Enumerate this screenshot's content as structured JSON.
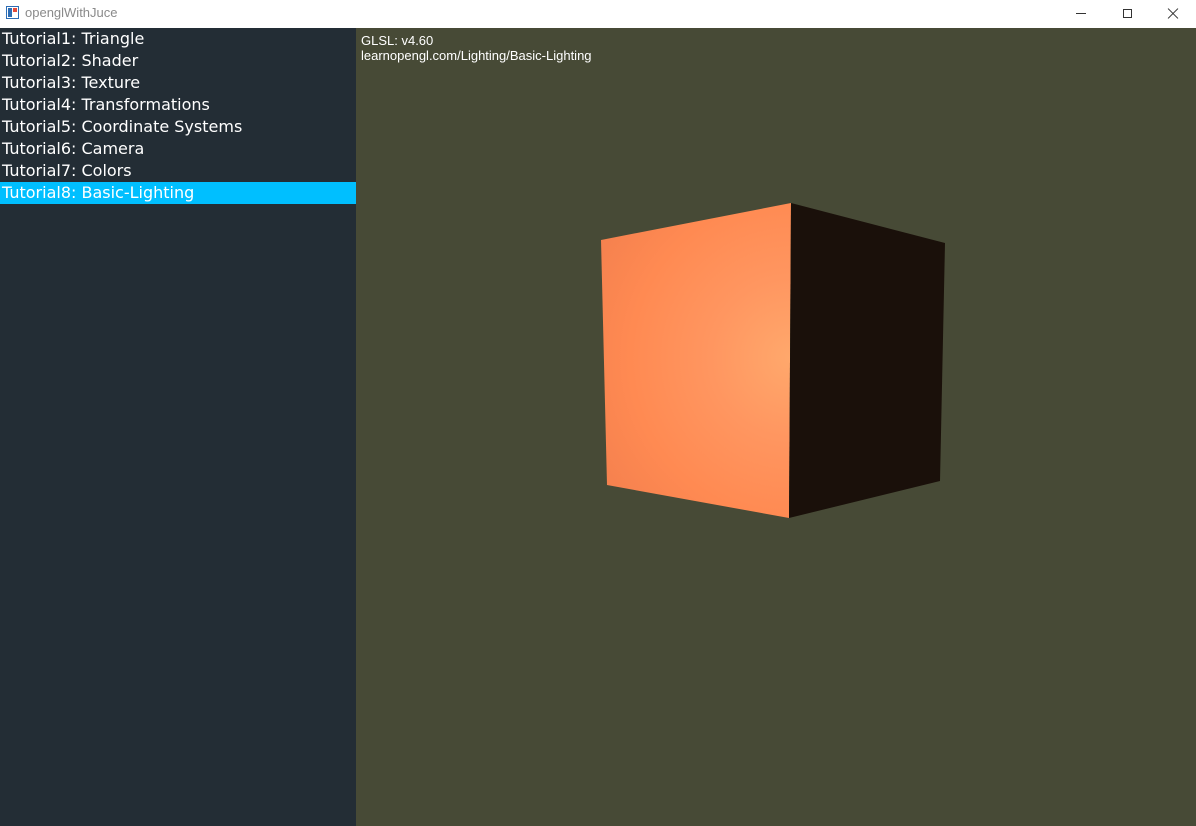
{
  "window": {
    "title": "openglWithJuce",
    "icons": {
      "app": "app-icon",
      "minimize": "minimize-icon",
      "maximize": "maximize-icon",
      "close": "close-icon"
    }
  },
  "sidebar": {
    "items": [
      {
        "label": "Tutorial1: Triangle",
        "selected": false
      },
      {
        "label": "Tutorial2: Shader",
        "selected": false
      },
      {
        "label": "Tutorial3: Texture",
        "selected": false
      },
      {
        "label": "Tutorial4: Transformations",
        "selected": false
      },
      {
        "label": "Tutorial5: Coordinate Systems",
        "selected": false
      },
      {
        "label": "Tutorial6: Camera",
        "selected": false
      },
      {
        "label": "Tutorial7: Colors",
        "selected": false
      },
      {
        "label": "Tutorial8: Basic-Lighting",
        "selected": true
      }
    ]
  },
  "viewport": {
    "glsl_version": "GLSL: v4.60",
    "tutorial_url": "learnopengl.com/Lighting/Basic-Lighting"
  },
  "colors": {
    "sidebar_bg": "#232d35",
    "selected_bg": "#00bfff",
    "viewport_bg": "#474a36",
    "cube_lit": "#ff8550",
    "cube_highlight": "#ffa86c",
    "cube_shadow": "#1a100a"
  }
}
